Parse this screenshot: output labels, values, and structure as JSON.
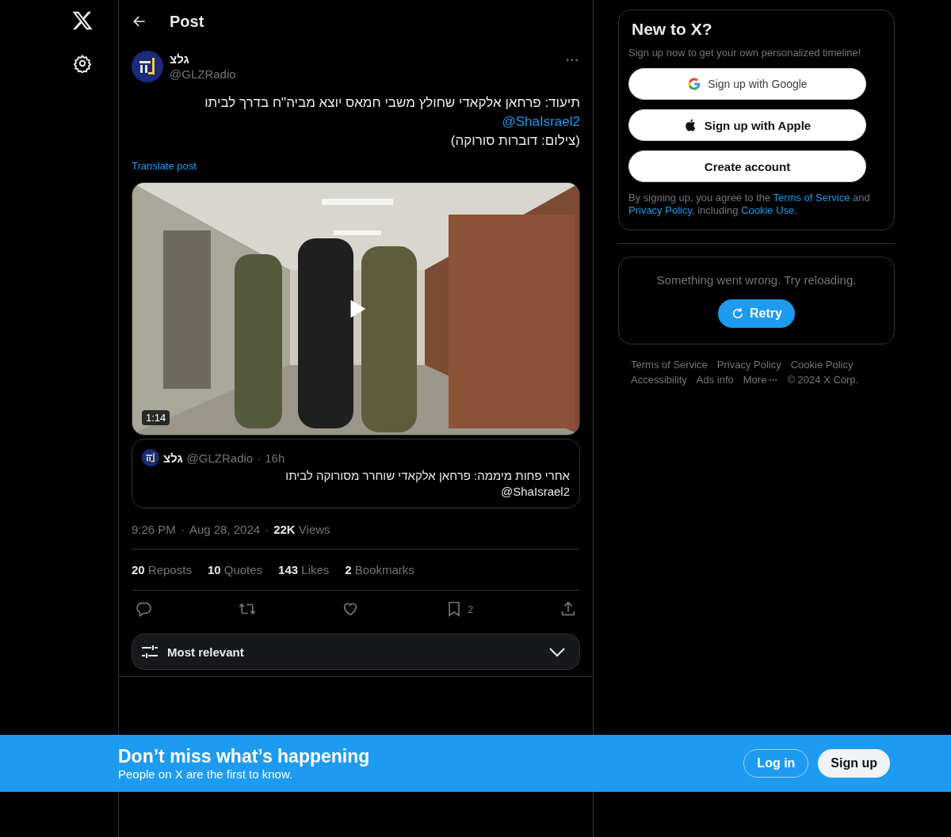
{
  "header": {
    "title": "Post"
  },
  "post": {
    "name": "גלצ",
    "handle": "@GLZRadio",
    "body": [
      {
        "kind": "text",
        "text": "תיעוד: פרחאן אלקאדי שחולץ משבי חמאס יוצא מביה\"ח בדרך לביתו"
      },
      {
        "kind": "mention",
        "text": "@ShaIsrael2"
      },
      {
        "kind": "text",
        "text": "(צילום: דוברות סורוקה)"
      }
    ],
    "translate": "Translate post",
    "video": {
      "duration": "1:14"
    },
    "quote": {
      "name": "גלצ",
      "handle": "@GLZRadio",
      "separator": "·",
      "time": "16h",
      "lines": [
        "אחרי פחות מיממה: פרחאן אלקאדי שוחרר מסורוקה לביתו",
        "@ShaIsrael2"
      ]
    },
    "meta": {
      "time": "9:26 PM",
      "separator_1": "·",
      "date": "Aug 28, 2024",
      "separator_2": "·",
      "views_count": "22K",
      "views_label": "Views"
    },
    "stats": [
      {
        "count": "20",
        "label": "Reposts"
      },
      {
        "count": "10",
        "label": "Quotes"
      },
      {
        "count": "143",
        "label": "Likes"
      },
      {
        "count": "2",
        "label": "Bookmarks"
      }
    ],
    "actions": [
      {
        "kind": "reply"
      },
      {
        "kind": "repost"
      },
      {
        "kind": "like"
      },
      {
        "kind": "bookmark",
        "count": "2"
      },
      {
        "kind": "share"
      }
    ],
    "sort": {
      "label": "Most relevant"
    }
  },
  "signup": {
    "title": "New to X?",
    "subtitle": "Sign up now to get your own personalized timeline!",
    "buttons": [
      {
        "kind": "google",
        "label": "Sign up with Google"
      },
      {
        "kind": "apple",
        "label": "Sign up with Apple"
      },
      {
        "kind": "plain",
        "label": "Create account"
      }
    ],
    "legal": [
      {
        "kind": "text",
        "text": "By signing up, you agree to the "
      },
      {
        "kind": "link",
        "text": "Terms of Service"
      },
      {
        "kind": "text",
        "text": " and "
      },
      {
        "kind": "link",
        "text": "Privacy Policy"
      },
      {
        "kind": "text",
        "text": ", including "
      },
      {
        "kind": "link",
        "text": "Cookie Use."
      }
    ]
  },
  "error": {
    "message": "Something went wrong. Try reloading.",
    "button": "Retry"
  },
  "footer": {
    "links": [
      "Terms of Service",
      "Privacy Policy",
      "Cookie Policy",
      "Accessibility",
      "Ads info",
      "More"
    ],
    "copyright": "© 2024 X Corp."
  },
  "banner": {
    "title": "Don’t miss what’s happening",
    "subtitle": "People on X are the first to know.",
    "buttons": [
      {
        "kind": "outline",
        "label": "Log in"
      },
      {
        "kind": "filled",
        "label": "Sign up"
      }
    ]
  }
}
